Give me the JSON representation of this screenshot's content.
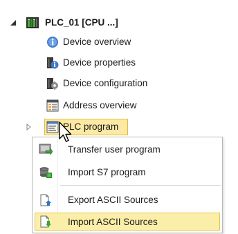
{
  "tree": {
    "root": {
      "label": "PLC_01 [CPU ...]",
      "expanded": true
    },
    "children": [
      {
        "label": "Device overview",
        "icon": "info-circle-icon"
      },
      {
        "label": "Device properties",
        "icon": "device-properties-icon"
      },
      {
        "label": "Device configuration",
        "icon": "device-configuration-icon"
      },
      {
        "label": "Address overview",
        "icon": "address-overview-icon"
      },
      {
        "label": "PLC program",
        "icon": "plc-program-icon",
        "selected": true,
        "expanded": false
      }
    ]
  },
  "context_menu": {
    "items": [
      {
        "label": "Transfer user program",
        "icon": "transfer-program-icon"
      },
      {
        "label": "Import S7 program",
        "icon": "import-s7-icon"
      },
      {
        "label": "Export ASCII Sources",
        "icon": "export-ascii-icon"
      },
      {
        "label": "Import ASCII Sources",
        "icon": "import-ascii-icon",
        "highlighted": true
      }
    ]
  },
  "colors": {
    "selection_fill": "#fbe9a4",
    "selection_border": "#e4b93c",
    "menu_border": "#b9b9b9"
  }
}
